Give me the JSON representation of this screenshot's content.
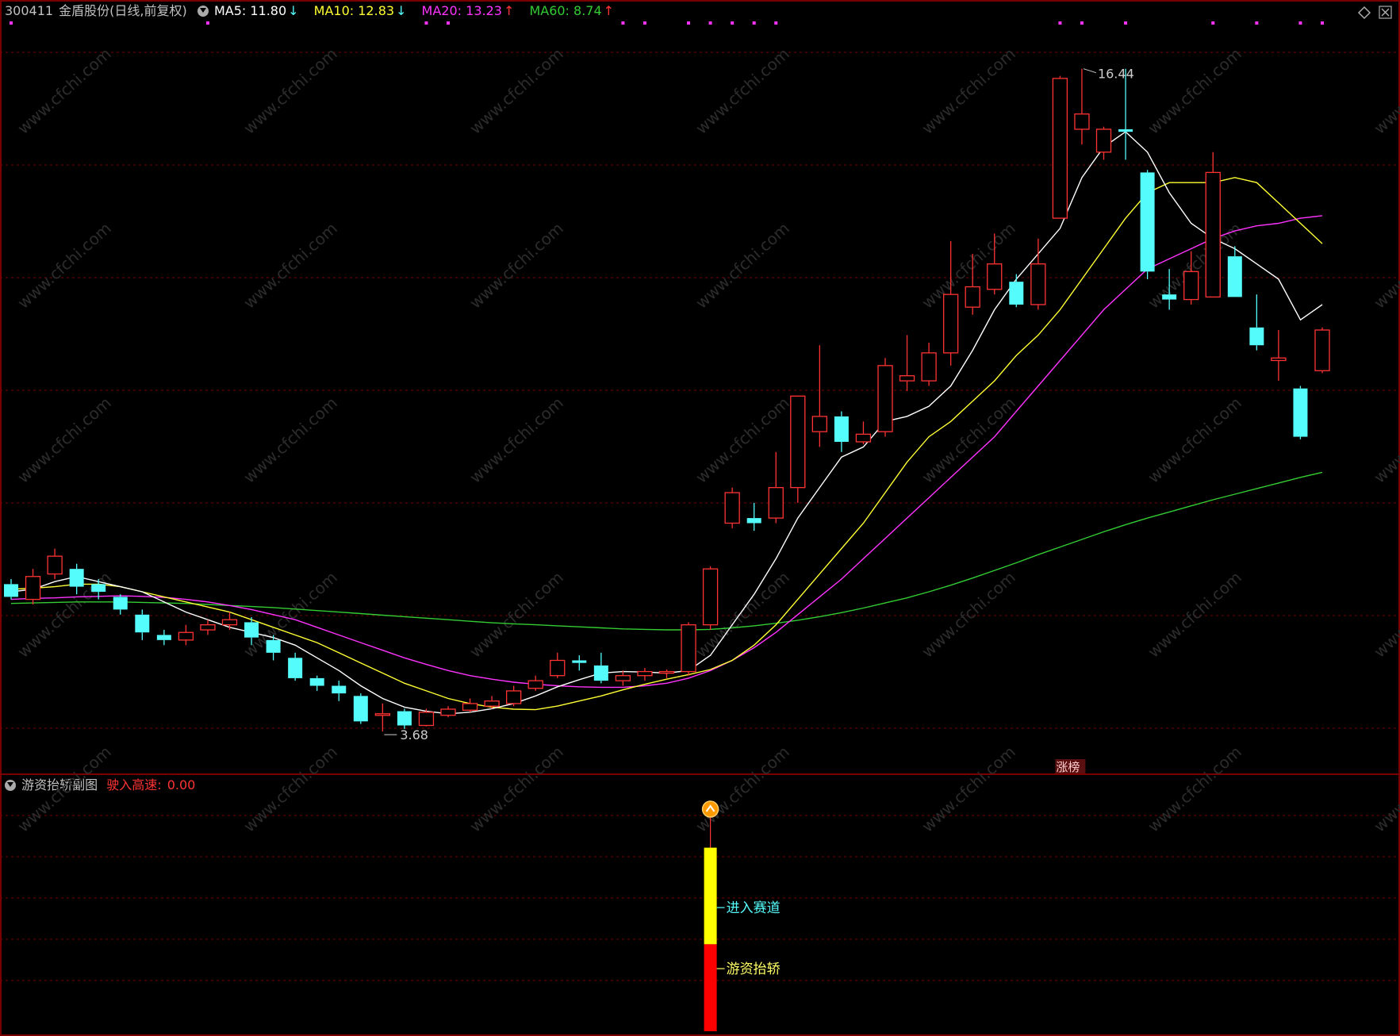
{
  "header": {
    "code": "300411",
    "name": "金盾股份(日线,前复权)",
    "ma5_label": "MA5: 11.80",
    "ma10_label": "MA10: 12.83",
    "ma20_label": "MA20: 13.23",
    "ma60_label": "MA60: 8.74",
    "ma5_arrow": "↓",
    "ma10_arrow": "↓",
    "ma20_arrow": "↑",
    "ma60_arrow": "↑"
  },
  "sub_header": {
    "title": "游资抬轿副图",
    "param_label": "驶入高速:",
    "param_value": "0.00"
  },
  "annotations": {
    "high_label": "16.44",
    "low_label": "3.68",
    "limit_up_tag": "涨榜",
    "enter_track": "进入赛道",
    "hot_money": "游资抬轿"
  },
  "watermark": "www.cfchi.com",
  "colors": {
    "up": "#ff3333",
    "down": "#54fcfc",
    "ma5": "#ffffff",
    "ma10": "#ffff33",
    "ma20": "#ff33ff",
    "ma60": "#33cc33",
    "grid": "#7a0000",
    "yellow_bar": "#ffff00",
    "red_bar": "#ff0000"
  },
  "chart_data": {
    "type": "candlestick",
    "ylim": [
      3.2,
      17.2
    ],
    "candles": [
      {
        "o": 6.3,
        "c": 6.05,
        "h": 6.4,
        "l": 6.0
      },
      {
        "o": 6.0,
        "c": 6.45,
        "h": 6.6,
        "l": 5.9
      },
      {
        "o": 6.5,
        "c": 6.85,
        "h": 7.0,
        "l": 6.4
      },
      {
        "o": 6.6,
        "c": 6.25,
        "h": 6.7,
        "l": 6.1
      },
      {
        "o": 6.3,
        "c": 6.15,
        "h": 6.4,
        "l": 6.0
      },
      {
        "o": 6.05,
        "c": 5.8,
        "h": 6.1,
        "l": 5.7
      },
      {
        "o": 5.7,
        "c": 5.35,
        "h": 5.8,
        "l": 5.2
      },
      {
        "o": 5.3,
        "c": 5.2,
        "h": 5.4,
        "l": 5.1
      },
      {
        "o": 5.2,
        "c": 5.35,
        "h": 5.5,
        "l": 5.1
      },
      {
        "o": 5.4,
        "c": 5.5,
        "h": 5.6,
        "l": 5.3
      },
      {
        "o": 5.5,
        "c": 5.6,
        "h": 5.75,
        "l": 5.4
      },
      {
        "o": 5.55,
        "c": 5.25,
        "h": 5.65,
        "l": 5.1
      },
      {
        "o": 5.2,
        "c": 4.95,
        "h": 5.3,
        "l": 4.8
      },
      {
        "o": 4.85,
        "c": 4.45,
        "h": 4.95,
        "l": 4.4
      },
      {
        "o": 4.45,
        "c": 4.3,
        "h": 4.5,
        "l": 4.2
      },
      {
        "o": 4.3,
        "c": 4.15,
        "h": 4.4,
        "l": 4.0
      },
      {
        "o": 4.1,
        "c": 3.6,
        "h": 4.15,
        "l": 3.55
      },
      {
        "o": 3.75,
        "c": 3.75,
        "h": 3.95,
        "l": 3.4
      },
      {
        "o": 3.8,
        "c": 3.52,
        "h": 3.85,
        "l": 3.45
      },
      {
        "o": 3.52,
        "c": 3.78,
        "h": 3.85,
        "l": 3.5
      },
      {
        "o": 3.72,
        "c": 3.84,
        "h": 3.9,
        "l": 3.68
      },
      {
        "o": 3.82,
        "c": 3.95,
        "h": 4.05,
        "l": 3.78
      },
      {
        "o": 3.9,
        "c": 4.0,
        "h": 4.1,
        "l": 3.85
      },
      {
        "o": 3.95,
        "c": 4.2,
        "h": 4.3,
        "l": 3.9
      },
      {
        "o": 4.25,
        "c": 4.4,
        "h": 4.5,
        "l": 4.2
      },
      {
        "o": 4.5,
        "c": 4.8,
        "h": 4.95,
        "l": 4.45
      },
      {
        "o": 4.8,
        "c": 4.75,
        "h": 4.9,
        "l": 4.6
      },
      {
        "o": 4.7,
        "c": 4.4,
        "h": 4.95,
        "l": 4.35
      },
      {
        "o": 4.4,
        "c": 4.5,
        "h": 4.6,
        "l": 4.3
      },
      {
        "o": 4.5,
        "c": 4.58,
        "h": 4.65,
        "l": 4.4
      },
      {
        "o": 4.55,
        "c": 4.58,
        "h": 4.62,
        "l": 4.45
      },
      {
        "o": 4.58,
        "c": 5.5,
        "h": 5.55,
        "l": 4.5
      },
      {
        "o": 5.5,
        "c": 6.6,
        "h": 6.65,
        "l": 5.4
      },
      {
        "o": 7.5,
        "c": 8.1,
        "h": 8.2,
        "l": 7.4
      },
      {
        "o": 7.6,
        "c": 7.5,
        "h": 7.9,
        "l": 7.35
      },
      {
        "o": 7.6,
        "c": 8.2,
        "h": 8.9,
        "l": 7.5
      },
      {
        "o": 8.2,
        "c": 10.0,
        "h": 10.0,
        "l": 7.9
      },
      {
        "o": 9.3,
        "c": 9.6,
        "h": 11.0,
        "l": 9.0
      },
      {
        "o": 9.6,
        "c": 9.1,
        "h": 9.7,
        "l": 8.9
      },
      {
        "o": 9.1,
        "c": 9.25,
        "h": 9.5,
        "l": 9.05
      },
      {
        "o": 9.3,
        "c": 10.6,
        "h": 10.75,
        "l": 9.2
      },
      {
        "o": 10.3,
        "c": 10.4,
        "h": 11.2,
        "l": 10.1
      },
      {
        "o": 10.3,
        "c": 10.85,
        "h": 11.05,
        "l": 10.2
      },
      {
        "o": 10.85,
        "c": 12.0,
        "h": 13.05,
        "l": 10.6
      },
      {
        "o": 11.75,
        "c": 12.15,
        "h": 12.8,
        "l": 11.6
      },
      {
        "o": 12.1,
        "c": 12.6,
        "h": 13.2,
        "l": 12.0
      },
      {
        "o": 12.25,
        "c": 11.8,
        "h": 12.4,
        "l": 11.75
      },
      {
        "o": 11.8,
        "c": 12.6,
        "h": 13.1,
        "l": 11.7
      },
      {
        "o": 13.5,
        "c": 16.25,
        "h": 16.3,
        "l": 13.5
      },
      {
        "o": 15.25,
        "c": 15.55,
        "h": 16.44,
        "l": 14.95
      },
      {
        "o": 14.8,
        "c": 15.25,
        "h": 15.3,
        "l": 14.65
      },
      {
        "o": 15.25,
        "c": 15.2,
        "h": 16.44,
        "l": 14.65
      },
      {
        "o": 14.4,
        "c": 12.45,
        "h": 14.45,
        "l": 12.3
      },
      {
        "o": 12.0,
        "c": 11.9,
        "h": 12.5,
        "l": 11.7
      },
      {
        "o": 11.9,
        "c": 12.45,
        "h": 12.85,
        "l": 11.8
      },
      {
        "o": 11.95,
        "c": 14.4,
        "h": 14.8,
        "l": 11.95
      },
      {
        "o": 12.75,
        "c": 11.95,
        "h": 12.95,
        "l": 11.95
      },
      {
        "o": 11.35,
        "c": 11.0,
        "h": 12.0,
        "l": 10.9
      },
      {
        "o": 10.7,
        "c": 10.75,
        "h": 11.3,
        "l": 10.3
      },
      {
        "o": 10.15,
        "c": 9.2,
        "h": 10.2,
        "l": 9.15
      },
      {
        "o": 10.5,
        "c": 11.3,
        "h": 11.35,
        "l": 10.45
      }
    ],
    "ma5": [
      6.15,
      6.2,
      6.35,
      6.45,
      6.35,
      6.25,
      6.15,
      5.95,
      5.75,
      5.6,
      5.45,
      5.35,
      5.25,
      5.1,
      4.85,
      4.6,
      4.3,
      4.05,
      3.88,
      3.8,
      3.75,
      3.78,
      3.85,
      3.95,
      4.1,
      4.28,
      4.42,
      4.55,
      4.58,
      4.57,
      4.55,
      4.6,
      4.9,
      5.5,
      6.1,
      6.8,
      7.6,
      8.2,
      8.8,
      9.0,
      9.5,
      9.6,
      9.8,
      10.2,
      10.9,
      11.7,
      12.3,
      12.8,
      13.3,
      14.3,
      14.9,
      15.2,
      14.8,
      14.0,
      13.4,
      13.1,
      12.9,
      12.6,
      12.3,
      11.5,
      11.8
    ],
    "ma10": [
      6.2,
      6.22,
      6.25,
      6.3,
      6.3,
      6.25,
      6.15,
      6.05,
      5.95,
      5.85,
      5.75,
      5.6,
      5.45,
      5.3,
      5.15,
      4.95,
      4.75,
      4.55,
      4.35,
      4.2,
      4.05,
      3.95,
      3.88,
      3.84,
      3.83,
      3.9,
      4.0,
      4.1,
      4.22,
      4.33,
      4.43,
      4.52,
      4.62,
      4.8,
      5.1,
      5.5,
      6.0,
      6.5,
      7.0,
      7.5,
      8.1,
      8.7,
      9.2,
      9.5,
      9.9,
      10.3,
      10.8,
      11.2,
      11.7,
      12.3,
      12.9,
      13.5,
      14.0,
      14.2,
      14.2,
      14.2,
      14.3,
      14.2,
      13.8,
      13.4,
      13.0
    ],
    "ma20": [
      6.0,
      6.02,
      6.03,
      6.05,
      6.06,
      6.07,
      6.06,
      6.04,
      6.0,
      5.95,
      5.88,
      5.8,
      5.7,
      5.6,
      5.45,
      5.3,
      5.15,
      5.0,
      4.85,
      4.72,
      4.6,
      4.5,
      4.43,
      4.37,
      4.33,
      4.3,
      4.28,
      4.27,
      4.27,
      4.3,
      4.35,
      4.45,
      4.6,
      4.8,
      5.05,
      5.35,
      5.7,
      6.05,
      6.4,
      6.8,
      7.2,
      7.6,
      8.0,
      8.4,
      8.8,
      9.2,
      9.7,
      10.2,
      10.7,
      11.2,
      11.7,
      12.1,
      12.5,
      12.7,
      12.9,
      13.1,
      13.25,
      13.35,
      13.4,
      13.5,
      13.55
    ],
    "ma60": [
      5.92,
      5.93,
      5.94,
      5.95,
      5.95,
      5.95,
      5.94,
      5.93,
      5.92,
      5.9,
      5.88,
      5.86,
      5.84,
      5.81,
      5.78,
      5.75,
      5.72,
      5.69,
      5.66,
      5.63,
      5.6,
      5.57,
      5.54,
      5.52,
      5.5,
      5.48,
      5.46,
      5.44,
      5.42,
      5.41,
      5.4,
      5.4,
      5.41,
      5.44,
      5.48,
      5.53,
      5.59,
      5.66,
      5.74,
      5.83,
      5.93,
      6.03,
      6.15,
      6.28,
      6.42,
      6.57,
      6.72,
      6.88,
      7.03,
      7.18,
      7.33,
      7.47,
      7.6,
      7.72,
      7.84,
      7.96,
      8.07,
      8.18,
      8.29,
      8.4,
      8.5
    ],
    "sub_bar": {
      "index": 32,
      "yellow_fraction": 0.4,
      "red_fraction": 0.38
    }
  }
}
